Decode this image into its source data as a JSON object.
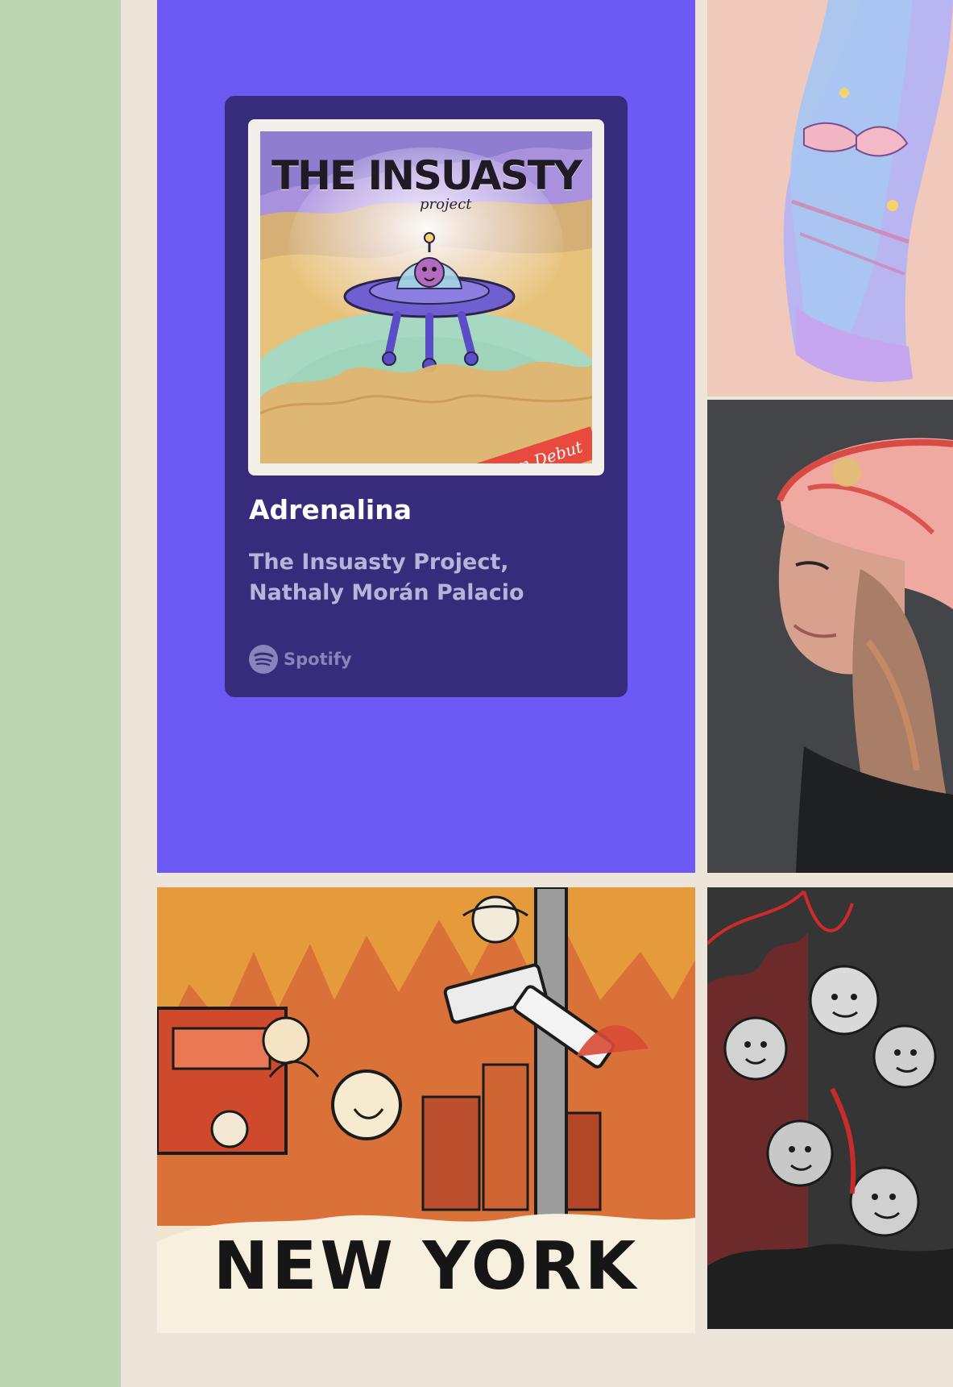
{
  "layout": {
    "colors": {
      "page_bg": "#ede5da",
      "left_strip": "#bed5b3",
      "spotify_tile_bg": "#6d5af5",
      "spotify_card_bg": "#372b7b",
      "spotify_artists": "#b8b3d8",
      "spotify_logo": "#8a84b9"
    }
  },
  "spotify_embed": {
    "track_title": "Adrenalina",
    "artists": "The Insuasty Project, Nathaly Morán Palacio",
    "platform_label": "Spotify",
    "icon": "spotify-logo-icon",
    "album_art": {
      "logo_text": "THE INSUASTY",
      "logo_subtext": "project",
      "badge_text": "Album Debut"
    }
  },
  "gallery": {
    "tiles": [
      {
        "name": "scarf-photo"
      },
      {
        "name": "portrait-photo"
      },
      {
        "name": "new-york-illustration",
        "text": "NEW YORK"
      },
      {
        "name": "dark-heroes-illustration"
      }
    ]
  }
}
